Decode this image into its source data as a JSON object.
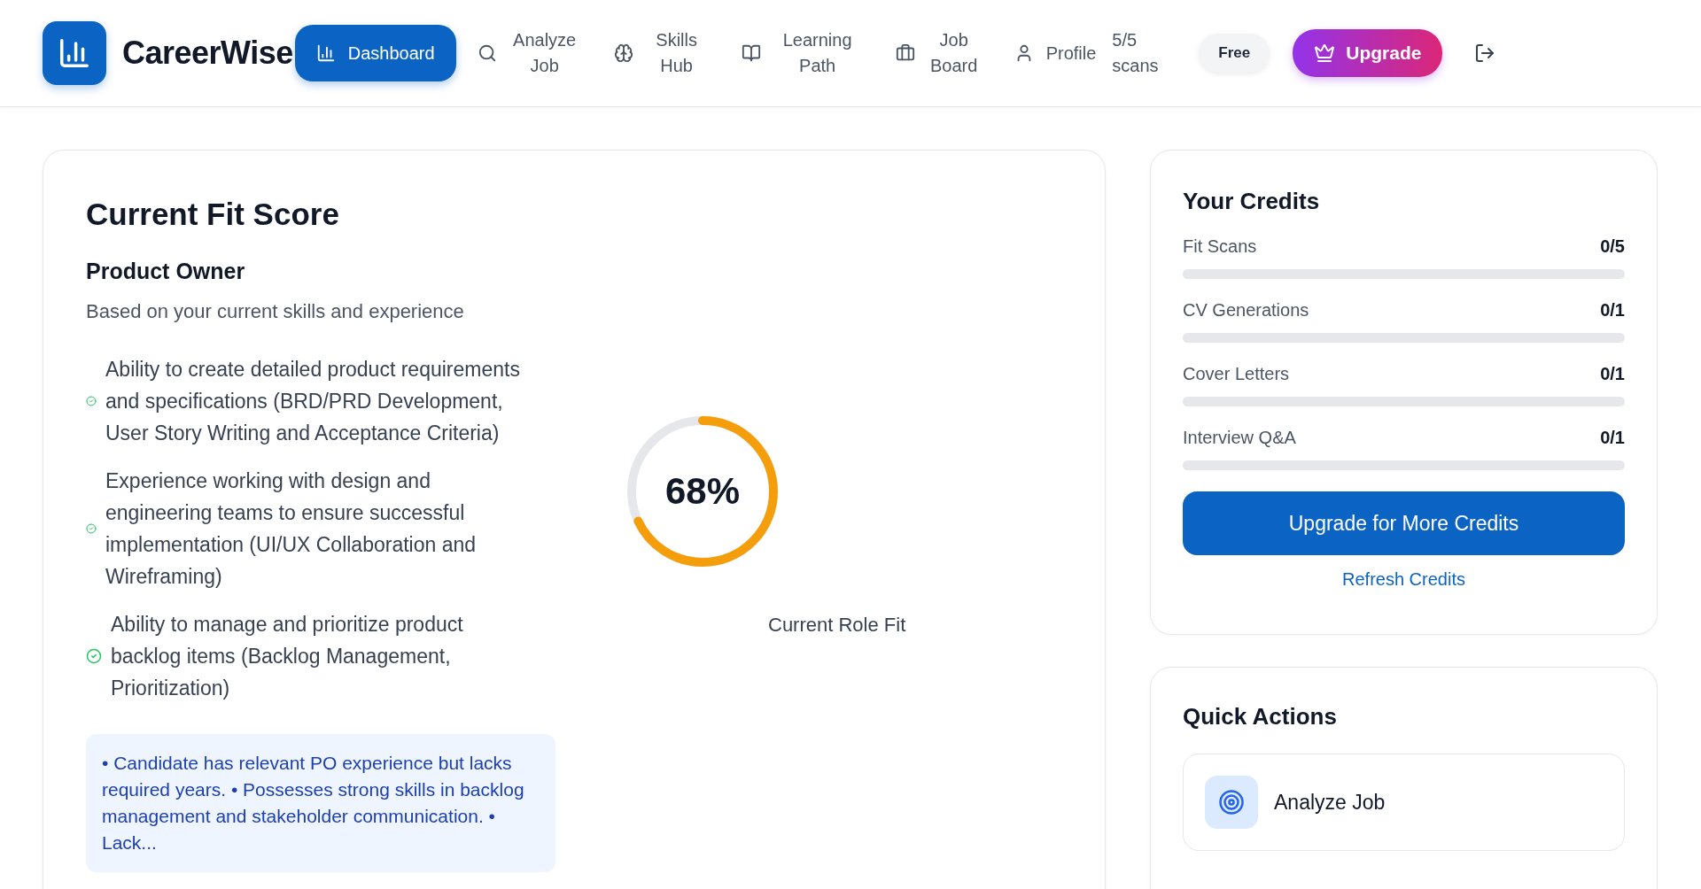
{
  "brand": {
    "name": "CareerWise"
  },
  "nav": [
    {
      "label": "Dashboard",
      "selected": true
    },
    {
      "label": "Analyze Job",
      "selected": false
    },
    {
      "label": "Skills Hub",
      "selected": false
    },
    {
      "label": "Learning Path",
      "selected": false
    },
    {
      "label": "Job Board",
      "selected": false
    },
    {
      "label": "Profile",
      "selected": false
    }
  ],
  "scans": "5/5 scans",
  "plan_badge": "Free",
  "upgrade_button": "Upgrade",
  "fit_card": {
    "title": "Current Fit Score",
    "role": "Product Owner",
    "description": "Based on your current skills and experience",
    "skills": [
      "Ability to create detailed product requirements and specifications (BRD/PRD Development, User Story Writing and Acceptance Criteria)",
      "Experience working with design and engineering teams to ensure successful implementation (UI/UX Collaboration and Wireframing)",
      "Ability to manage and prioritize product backlog items (Backlog Management, Prioritization)"
    ],
    "gauge": {
      "value": "68%",
      "level": 0.68,
      "label": "Current Role Fit"
    },
    "summary": "• Candidate has relevant PO experience but lacks required years. • Possesses strong skills in backlog management and stakeholder communication. • Lack..."
  },
  "credits": {
    "title": "Your Credits",
    "items": [
      {
        "name": "Fit Scans",
        "value": "0/5",
        "level": 0
      },
      {
        "name": "CV Generations",
        "value": "0/1",
        "level": 0
      },
      {
        "name": "Cover Letters",
        "value": "0/1",
        "level": 0
      },
      {
        "name": "Interview Q&A",
        "value": "0/1",
        "level": 0
      }
    ],
    "button": "Upgrade for More Credits",
    "link": "Refresh Credits"
  },
  "quick_actions": {
    "title": "Quick Actions",
    "items": [
      {
        "label": "Analyze Job"
      }
    ]
  }
}
